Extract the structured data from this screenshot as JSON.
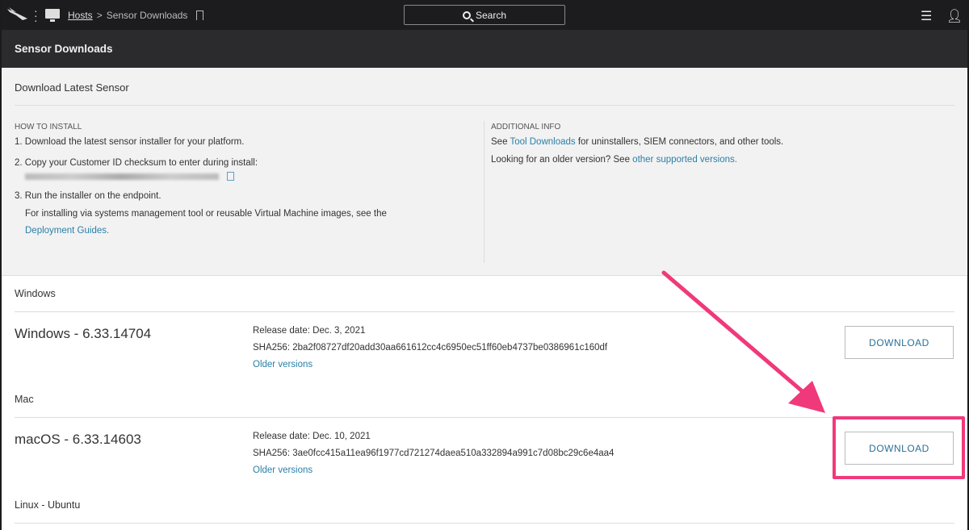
{
  "topbar": {
    "breadcrumb_link": "Hosts",
    "breadcrumb_sep": ">",
    "breadcrumb_current": "Sensor Downloads",
    "search_label": "Search"
  },
  "header": {
    "title": "Sensor Downloads"
  },
  "panel": {
    "title": "Download Latest Sensor",
    "how": {
      "caption": "HOW TO INSTALL",
      "step1": "1. Download the latest sensor installer for your platform.",
      "step2": "2. Copy your Customer ID checksum to enter during install:",
      "step3": "3. Run the installer on the endpoint.",
      "step3_note": "For installing via systems management tool or reusable Virtual Machine images, see the",
      "step3_link": "Deployment Guides",
      "step3_end": "."
    },
    "info": {
      "caption": "ADDITIONAL INFO",
      "line1_pre": "See ",
      "line1_link": "Tool Downloads",
      "line1_post": " for uninstallers, SIEM connectors, and other tools.",
      "line2_pre": "Looking for an older version? See ",
      "line2_link": "other supported versions",
      "line2_post": "."
    }
  },
  "sections": [
    {
      "label": "Windows",
      "name": "Windows - 6.33.14704",
      "release": "Release date: Dec. 3, 2021",
      "sha": "SHA256: 2ba2f08727df20add30aa661612cc4c6950ec51ff60eb4737be0386961c160df",
      "older": "Older versions",
      "download": "DOWNLOAD"
    },
    {
      "label": "Mac",
      "name": "macOS - 6.33.14603",
      "release": "Release date: Dec. 10, 2021",
      "sha": "SHA256: 3ae0fcc415a11ea96f1977cd721274daea510a332894a991c7d08bc29c6e4aa4",
      "older": "Older versions",
      "download": "DOWNLOAD"
    },
    {
      "label": "Linux - Ubuntu"
    }
  ],
  "colors": {
    "annotation": "#f0397a",
    "link": "#2a7fa8"
  }
}
